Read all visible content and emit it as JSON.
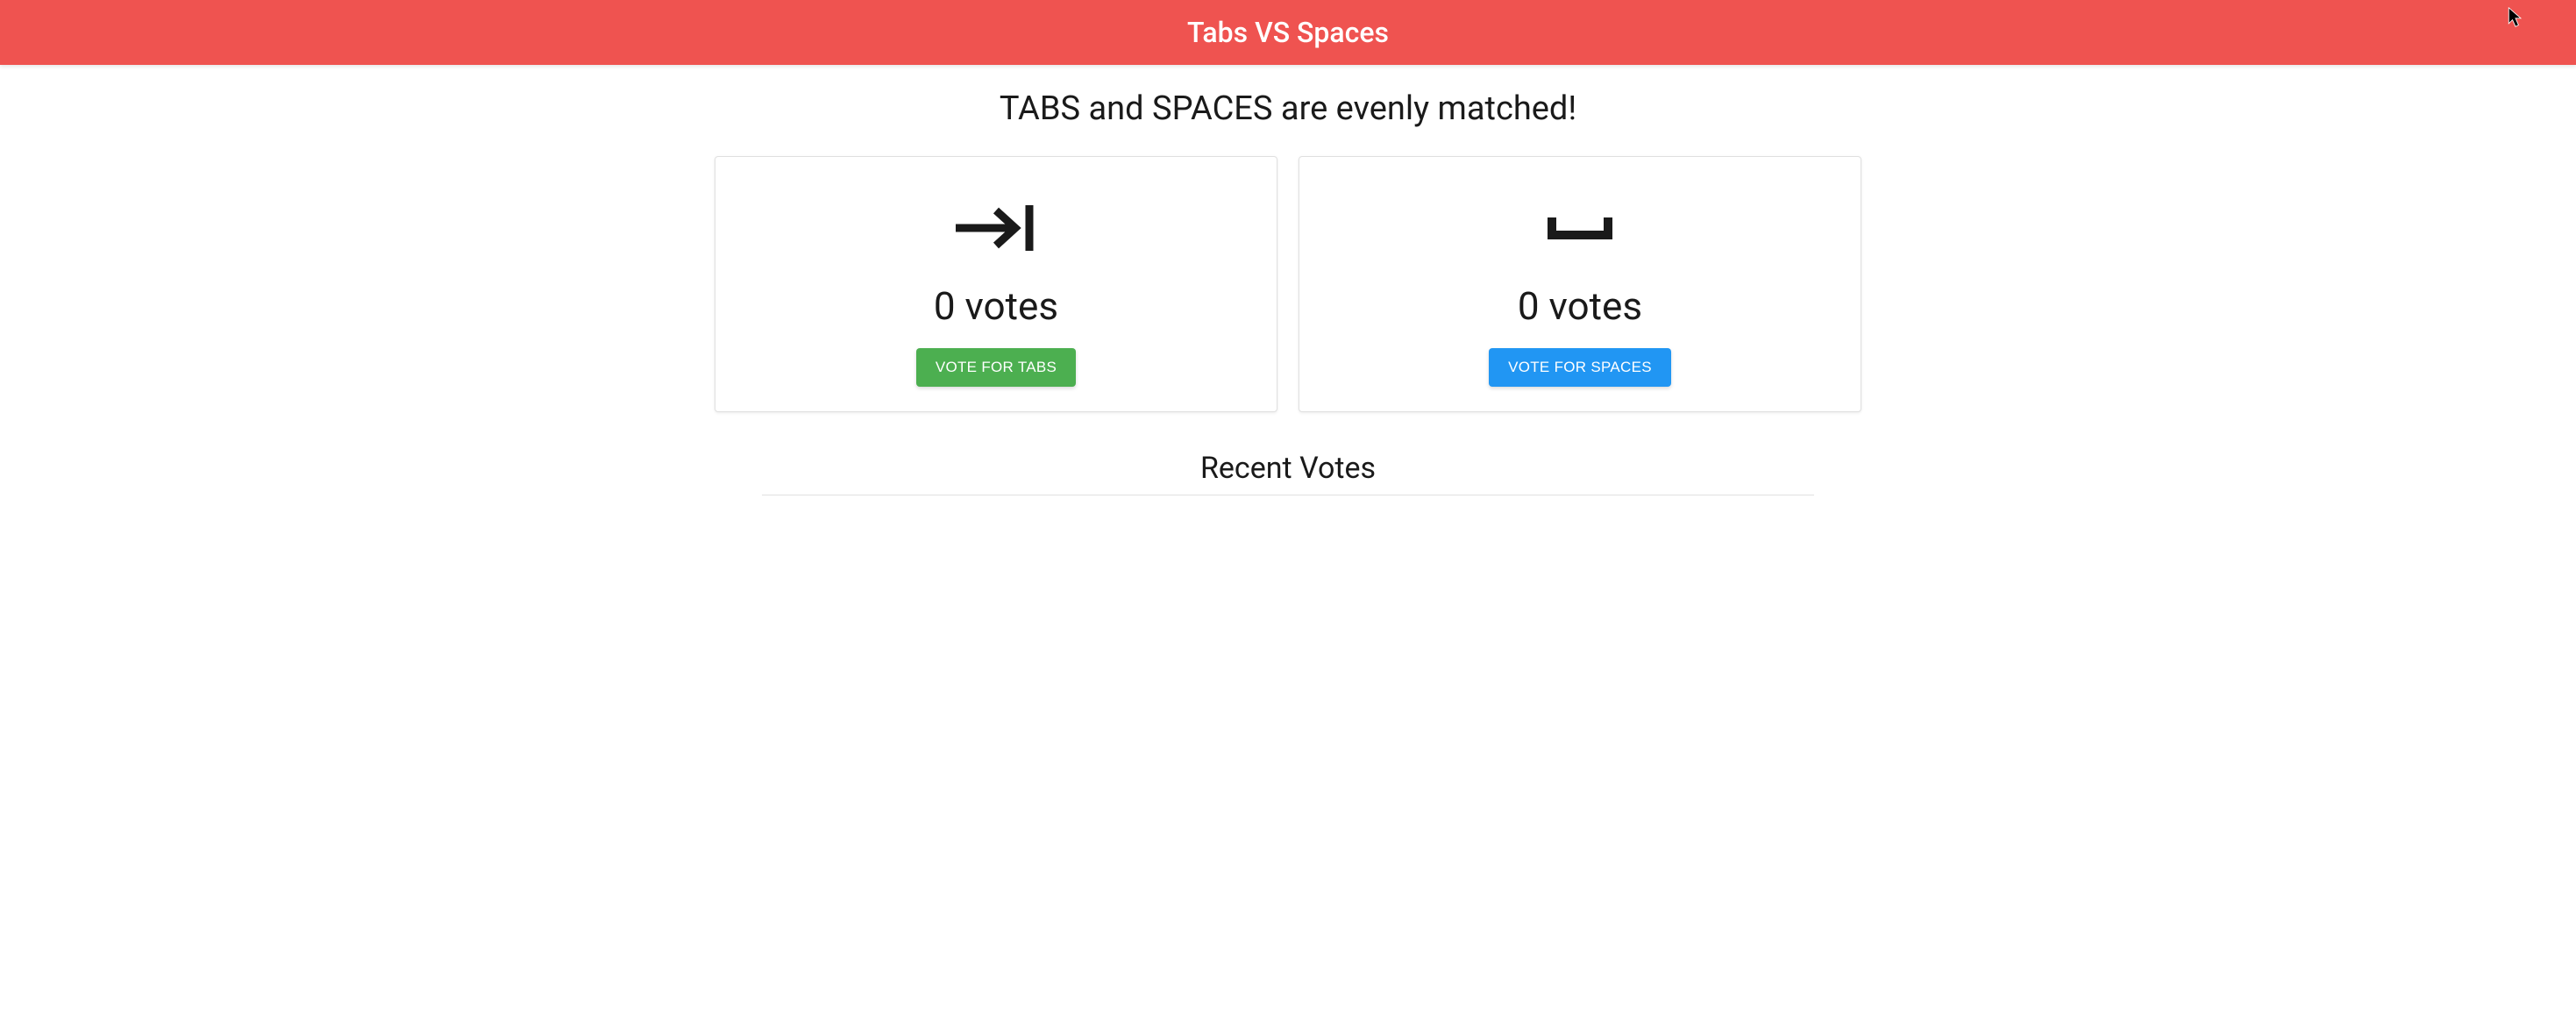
{
  "header": {
    "title": "Tabs VS Spaces"
  },
  "status": {
    "heading": "TABS and SPACES are evenly matched!"
  },
  "cards": {
    "tabs": {
      "vote_count_text": "0 votes",
      "button_label": "VOTE FOR TABS"
    },
    "spaces": {
      "vote_count_text": "0 votes",
      "button_label": "VOTE FOR SPACES"
    }
  },
  "recent": {
    "heading": "Recent Votes"
  },
  "colors": {
    "header_bg": "#ef5350",
    "btn_green": "#4caf50",
    "btn_blue": "#2196f3"
  }
}
